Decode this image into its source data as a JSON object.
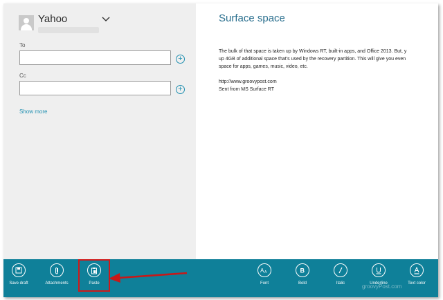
{
  "account": {
    "name": "Yahoo"
  },
  "fields": {
    "to_label": "To",
    "to_value": "",
    "cc_label": "Cc",
    "cc_value": "",
    "show_more": "Show more"
  },
  "message": {
    "subject": "Surface space",
    "body": "The bulk of that space is taken up by Windows RT, built-in apps, and Office 2013. But, y\nup 4GB of additional space that’s used by the recovery partition. This will give you even\nspace for apps, games, music, video, etc.\n\nhttp://www.groovypost.com\nSent from MS Surface RT"
  },
  "appbar": {
    "save_draft": "Save draft",
    "attachments": "Attachments",
    "paste": "Paste",
    "font": "Font",
    "bold": "Bold",
    "italic": "Italic",
    "underline": "Underline",
    "text_color": "Text color"
  },
  "watermark": "groovyPost.com",
  "colors": {
    "accent": "#0f8099",
    "link": "#1f8fb0",
    "highlight": "#d01919"
  },
  "icons": [
    "person-icon",
    "chevron-down-icon",
    "plus-icon",
    "save-icon",
    "paperclip-icon",
    "clipboard-icon",
    "font-icon",
    "bold-icon",
    "italic-icon",
    "underline-icon",
    "text-color-icon",
    "arrow-icon"
  ]
}
